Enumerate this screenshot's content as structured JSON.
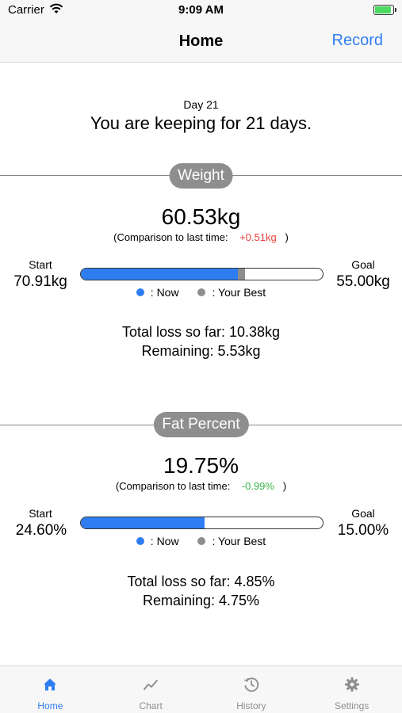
{
  "status_bar": {
    "carrier": "Carrier",
    "time": "9:09 AM"
  },
  "nav": {
    "title": "Home",
    "record_label": "Record"
  },
  "header": {
    "day": "Day 21",
    "message": "You are keeping for 21 days."
  },
  "weight": {
    "title": "Weight",
    "value": "60.53kg",
    "comparison_prefix": "(Comparison to last time:",
    "comparison_delta": "+0.51kg",
    "comparison_suffix": ")",
    "start_label": "Start",
    "start_value": "70.91kg",
    "goal_label": "Goal",
    "goal_value": "55.00kg",
    "progress_now": 0.65,
    "progress_best": 0.68,
    "legend_now": ": Now",
    "legend_best": ": Your Best",
    "total_loss": "Total loss so far: 10.38kg",
    "remaining": "Remaining: 5.53kg"
  },
  "fat": {
    "title": "Fat Percent",
    "value": "19.75%",
    "comparison_prefix": "(Comparison to last time:",
    "comparison_delta": "-0.99%",
    "comparison_suffix": ")",
    "start_label": "Start",
    "start_value": "24.60%",
    "goal_label": "Goal",
    "goal_value": "15.00%",
    "progress_now": 0.51,
    "progress_best": 0.51,
    "legend_now": ": Now",
    "legend_best": ": Your Best",
    "total_loss": "Total loss so far: 4.85%",
    "remaining": "Remaining: 4.75%"
  },
  "tabs": [
    {
      "label": "Home",
      "icon": "home-icon",
      "active": true
    },
    {
      "label": "Chart",
      "icon": "chart-icon",
      "active": false
    },
    {
      "label": "History",
      "icon": "history-icon",
      "active": false
    },
    {
      "label": "Settings",
      "icon": "settings-icon",
      "active": false
    }
  ],
  "colors": {
    "accent": "#2f7ef1",
    "best": "#8e8e8e",
    "increase": "#e8403b",
    "decrease": "#3ab64b"
  }
}
